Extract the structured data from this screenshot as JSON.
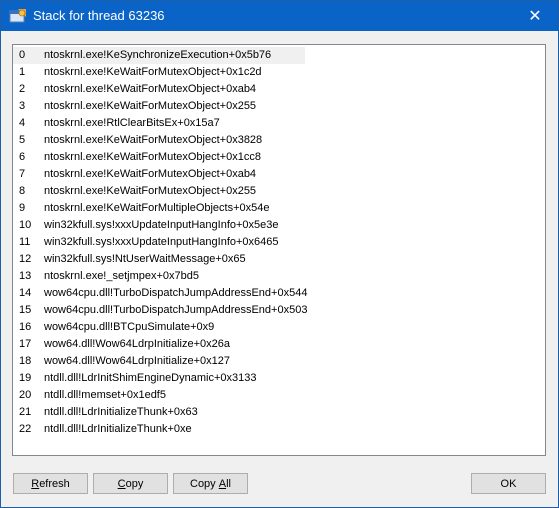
{
  "window": {
    "title": "Stack for thread 63236",
    "close_glyph": "✕"
  },
  "stack": {
    "rows": [
      {
        "index": "0",
        "frame": "ntoskrnl.exe!KeSynchronizeExecution+0x5b76"
      },
      {
        "index": "1",
        "frame": "ntoskrnl.exe!KeWaitForMutexObject+0x1c2d"
      },
      {
        "index": "2",
        "frame": "ntoskrnl.exe!KeWaitForMutexObject+0xab4"
      },
      {
        "index": "3",
        "frame": "ntoskrnl.exe!KeWaitForMutexObject+0x255"
      },
      {
        "index": "4",
        "frame": "ntoskrnl.exe!RtlClearBitsEx+0x15a7"
      },
      {
        "index": "5",
        "frame": "ntoskrnl.exe!KeWaitForMutexObject+0x3828"
      },
      {
        "index": "6",
        "frame": "ntoskrnl.exe!KeWaitForMutexObject+0x1cc8"
      },
      {
        "index": "7",
        "frame": "ntoskrnl.exe!KeWaitForMutexObject+0xab4"
      },
      {
        "index": "8",
        "frame": "ntoskrnl.exe!KeWaitForMutexObject+0x255"
      },
      {
        "index": "9",
        "frame": "ntoskrnl.exe!KeWaitForMultipleObjects+0x54e"
      },
      {
        "index": "10",
        "frame": "win32kfull.sys!xxxUpdateInputHangInfo+0x5e3e"
      },
      {
        "index": "11",
        "frame": "win32kfull.sys!xxxUpdateInputHangInfo+0x6465"
      },
      {
        "index": "12",
        "frame": "win32kfull.sys!NtUserWaitMessage+0x65"
      },
      {
        "index": "13",
        "frame": "ntoskrnl.exe!_setjmpex+0x7bd5"
      },
      {
        "index": "14",
        "frame": "wow64cpu.dll!TurboDispatchJumpAddressEnd+0x544"
      },
      {
        "index": "15",
        "frame": "wow64cpu.dll!TurboDispatchJumpAddressEnd+0x503"
      },
      {
        "index": "16",
        "frame": "wow64cpu.dll!BTCpuSimulate+0x9"
      },
      {
        "index": "17",
        "frame": "wow64.dll!Wow64LdrpInitialize+0x26a"
      },
      {
        "index": "18",
        "frame": "wow64.dll!Wow64LdrpInitialize+0x127"
      },
      {
        "index": "19",
        "frame": "ntdll.dll!LdrInitShimEngineDynamic+0x3133"
      },
      {
        "index": "20",
        "frame": "ntdll.dll!memset+0x1edf5"
      },
      {
        "index": "21",
        "frame": "ntdll.dll!LdrInitializeThunk+0x63"
      },
      {
        "index": "22",
        "frame": "ntdll.dll!LdrInitializeThunk+0xe"
      }
    ]
  },
  "buttons": {
    "refresh_mnemonic": "R",
    "refresh_rest": "efresh",
    "copy_mnemonic": "C",
    "copy_rest": "opy",
    "copyall_prefix": "Copy ",
    "copyall_mnemonic": "A",
    "copyall_rest": "ll",
    "ok": "OK"
  }
}
